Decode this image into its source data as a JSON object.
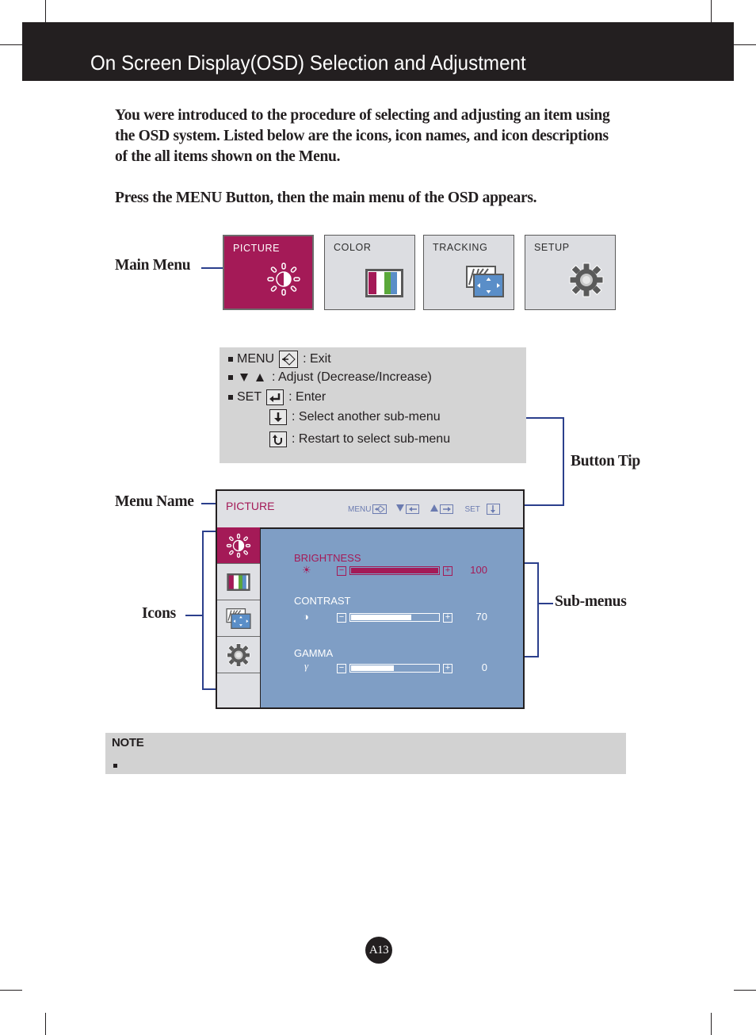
{
  "header": {
    "title": "On Screen Display(OSD) Selection and Adjustment"
  },
  "intro": {
    "paragraph_1": "You were introduced to the procedure of selecting and adjusting an item using the OSD system.  Listed below are the icons, icon names, and icon descriptions of the all items shown on the Menu.",
    "paragraph_2": "Press the MENU Button, then the main menu of the OSD appears."
  },
  "callouts": {
    "main_menu": "Main Menu",
    "button_tip": "Button Tip",
    "menu_name": "Menu Name",
    "icons": "Icons",
    "sub_menus": "Sub-menus"
  },
  "main_menu": {
    "items": [
      {
        "label": "PICTURE",
        "icon": "brightness-icon",
        "active": true
      },
      {
        "label": "COLOR",
        "icon": "color-bars-icon",
        "active": false
      },
      {
        "label": "TRACKING",
        "icon": "tracking-icon",
        "active": false
      },
      {
        "label": "SETUP",
        "icon": "gear-icon",
        "active": false
      }
    ]
  },
  "button_tip": {
    "rows": [
      {
        "prefix": "MENU",
        "icon": "exit-arrow-icon",
        "text": ": Exit"
      },
      {
        "prefix": "",
        "icon": "down-up-triangles-icon",
        "text": ": Adjust (Decrease/Increase)"
      },
      {
        "prefix": "SET",
        "icon": "enter-icon",
        "text": ": Enter"
      },
      {
        "prefix": "",
        "icon": "down-arrow-icon",
        "text": ": Select another sub-menu"
      },
      {
        "prefix": "",
        "icon": "restart-icon",
        "text": ": Restart to select sub-menu"
      }
    ]
  },
  "osd": {
    "menu_name": "PICTURE",
    "keys": {
      "menu": "MENU",
      "set": "SET"
    },
    "side_icons": [
      "brightness-icon",
      "color-bars-icon",
      "tracking-icon",
      "gear-icon"
    ],
    "submenus": [
      {
        "label": "BRIGHTNESS",
        "icon": "☀",
        "value": "100",
        "level": 100,
        "selected": true
      },
      {
        "label": "CONTRAST",
        "icon": "◑",
        "value": "70",
        "level": 70,
        "selected": false
      },
      {
        "label": "GAMMA",
        "icon": "γ",
        "value": "0",
        "level": 50,
        "selected": false
      }
    ]
  },
  "note": {
    "title": "NOTE",
    "items": [
      ""
    ]
  },
  "page": {
    "number": "A13"
  },
  "colors": {
    "accent": "#a41a57",
    "osd_panel": "#7f9ec5",
    "callout_line": "#2b3f8c",
    "header_bar": "#231f20"
  }
}
